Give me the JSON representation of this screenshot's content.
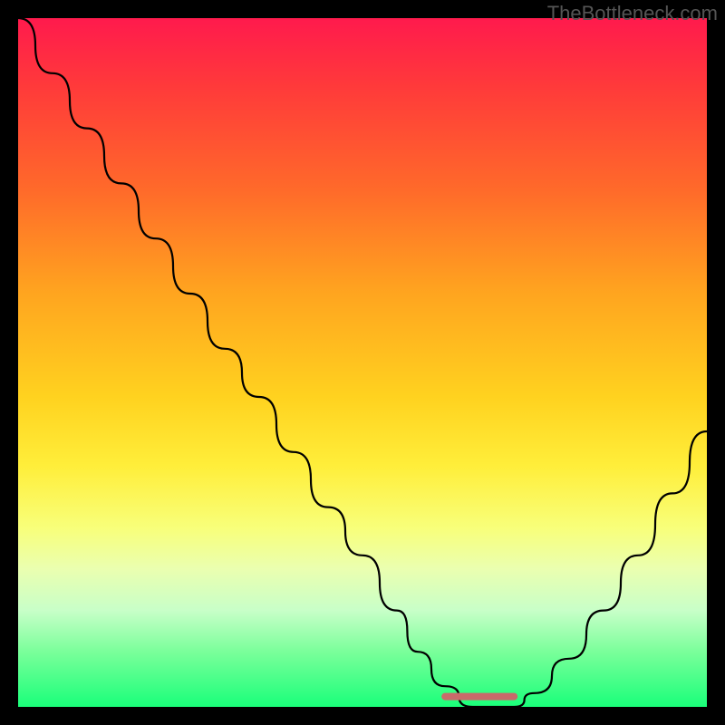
{
  "watermark": "TheBottleneck.com",
  "chart_data": {
    "type": "line",
    "title": "",
    "xlabel": "",
    "ylabel": "",
    "xlim": [
      0,
      100
    ],
    "ylim": [
      0,
      100
    ],
    "series": [
      {
        "name": "bottleneck-curve",
        "x": [
          0,
          5,
          10,
          15,
          20,
          25,
          30,
          35,
          40,
          45,
          50,
          55,
          58,
          62,
          66,
          70,
          72,
          75,
          80,
          85,
          90,
          95,
          100
        ],
        "y": [
          100,
          92,
          84,
          76,
          68,
          60,
          52,
          45,
          37,
          29,
          22,
          14,
          8,
          3,
          0,
          0,
          0,
          2,
          7,
          14,
          22,
          31,
          40
        ]
      },
      {
        "name": "optimal-marker",
        "color": "#cc6666",
        "x": [
          62,
          66,
          70,
          72
        ],
        "y": [
          1.5,
          1.5,
          1.5,
          1.5
        ]
      }
    ],
    "gradient_bands": [
      {
        "pct": 0,
        "color": "#ff1a4d"
      },
      {
        "pct": 50,
        "color": "#ffd21f"
      },
      {
        "pct": 100,
        "color": "#1aff7a"
      }
    ]
  }
}
